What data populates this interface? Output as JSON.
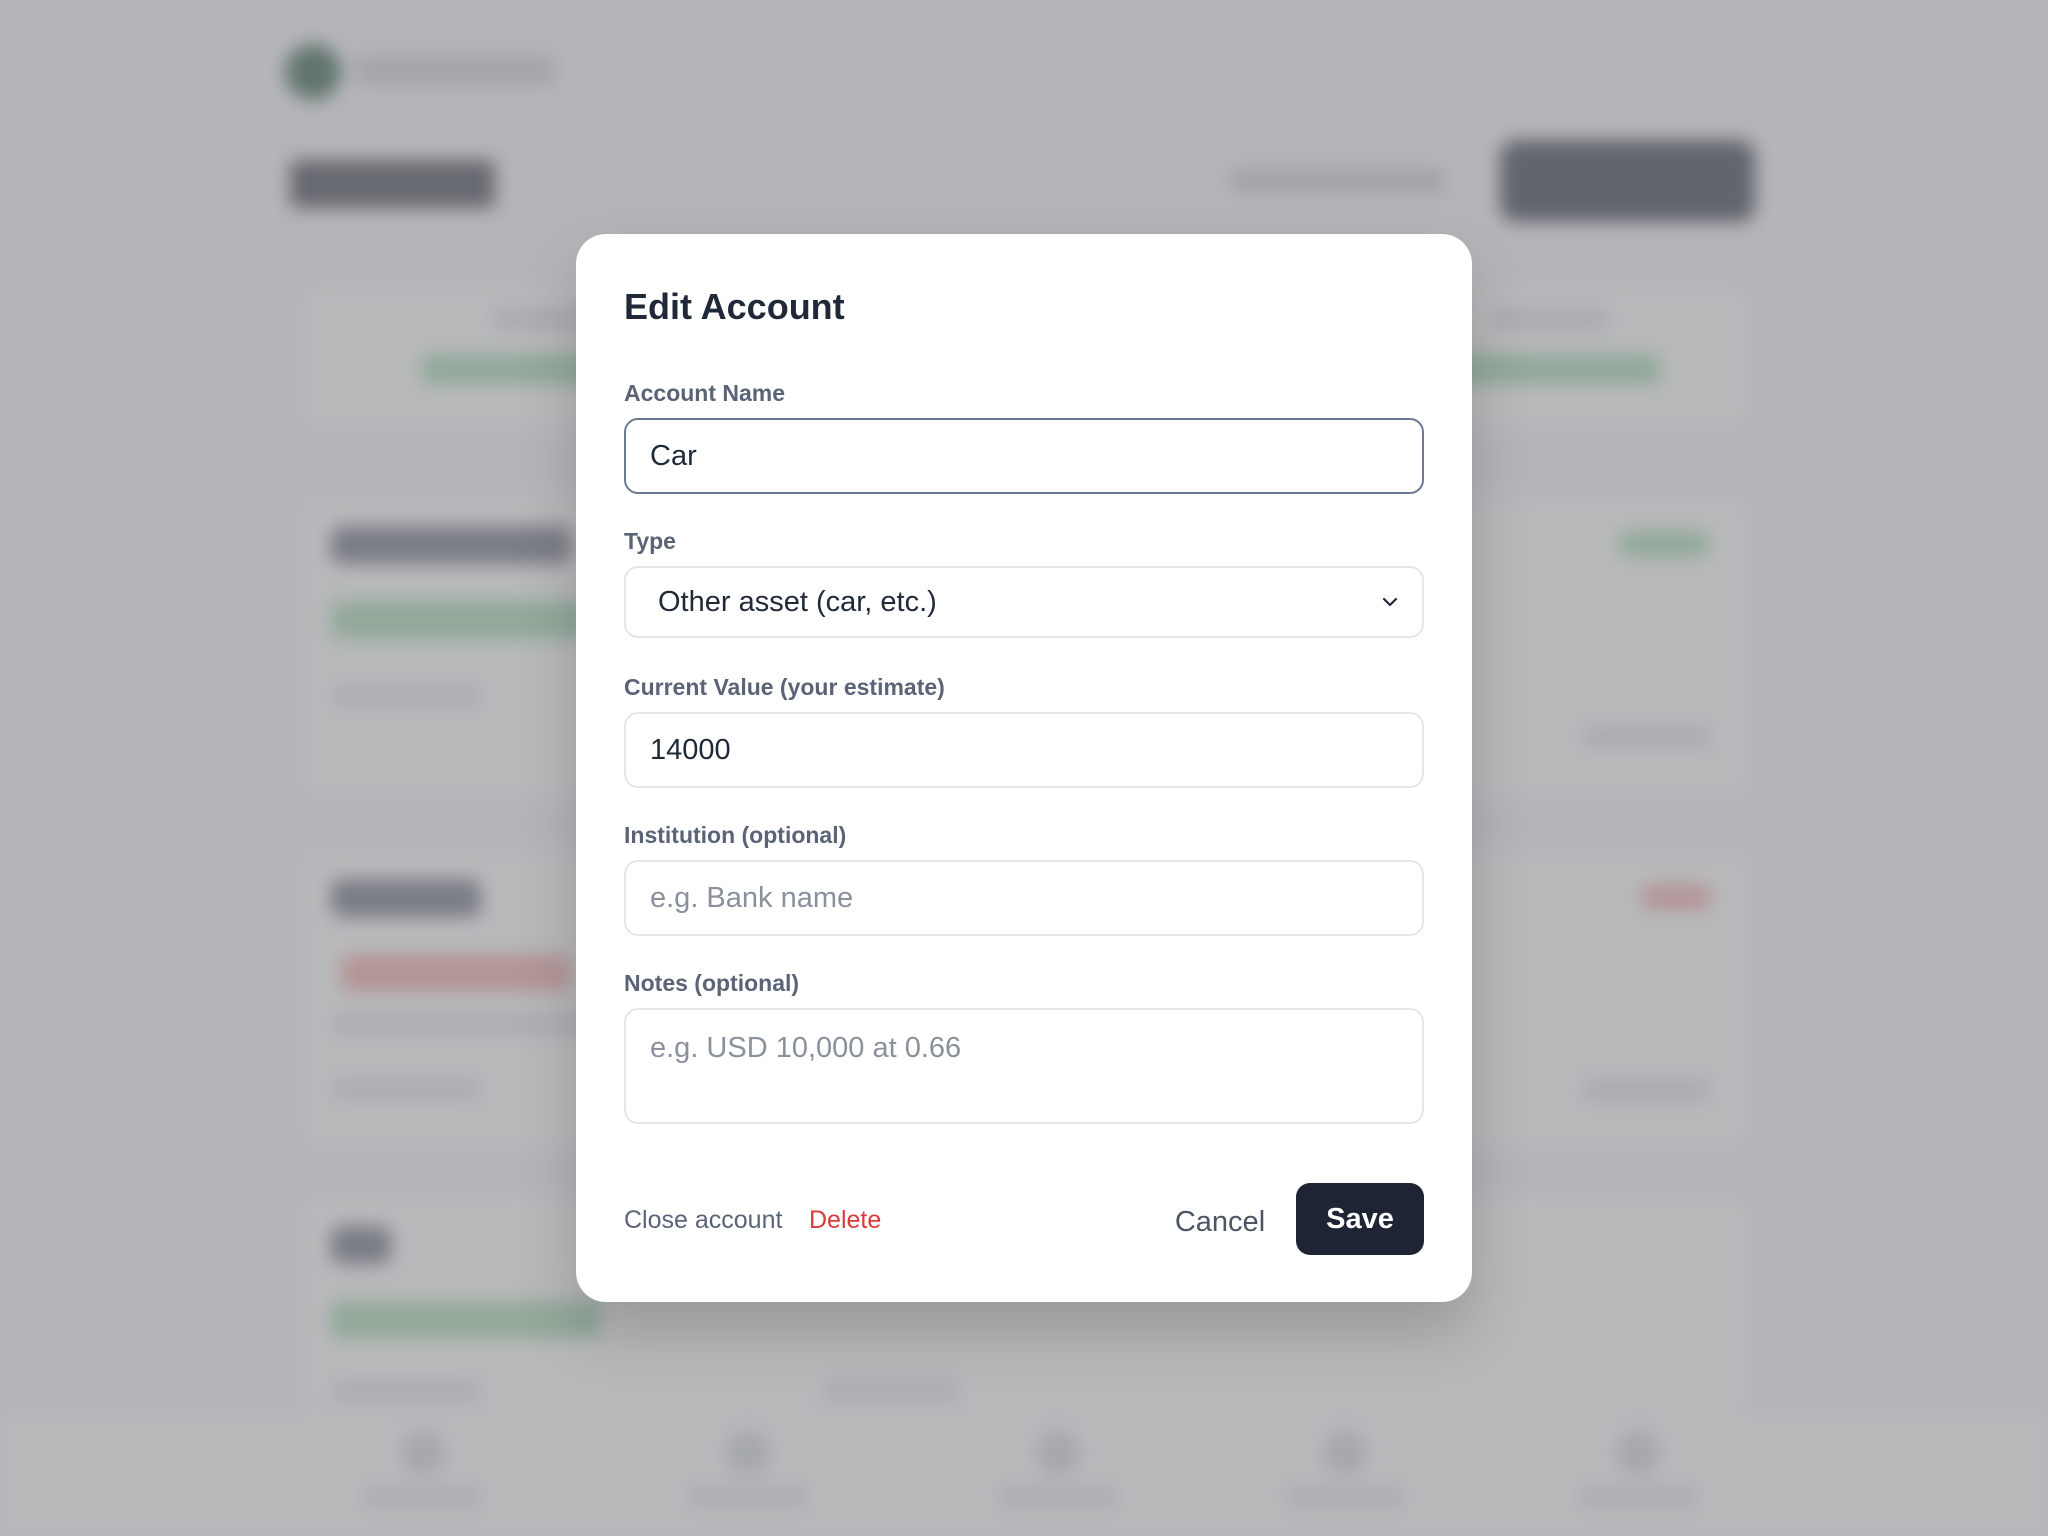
{
  "modal": {
    "title": "Edit Account",
    "fields": {
      "account_name": {
        "label": "Account Name",
        "value": "Car"
      },
      "type": {
        "label": "Type",
        "value": "Other asset (car, etc.)"
      },
      "current_value": {
        "label": "Current Value (your estimate)",
        "value": "14000"
      },
      "institution": {
        "label": "Institution (optional)",
        "placeholder": "e.g. Bank name"
      },
      "notes": {
        "label": "Notes (optional)",
        "placeholder": "e.g. USD 10,000 at 0.66"
      }
    },
    "footer": {
      "close_account_label": "Close account",
      "delete_label": "Delete",
      "cancel_label": "Cancel",
      "save_label": "Save"
    }
  },
  "colors": {
    "primary_button": "#1e2433",
    "danger": "#dc3b3b",
    "label": "#5a6476"
  },
  "icons": {
    "select_arrow": "chevron-down-icon"
  }
}
